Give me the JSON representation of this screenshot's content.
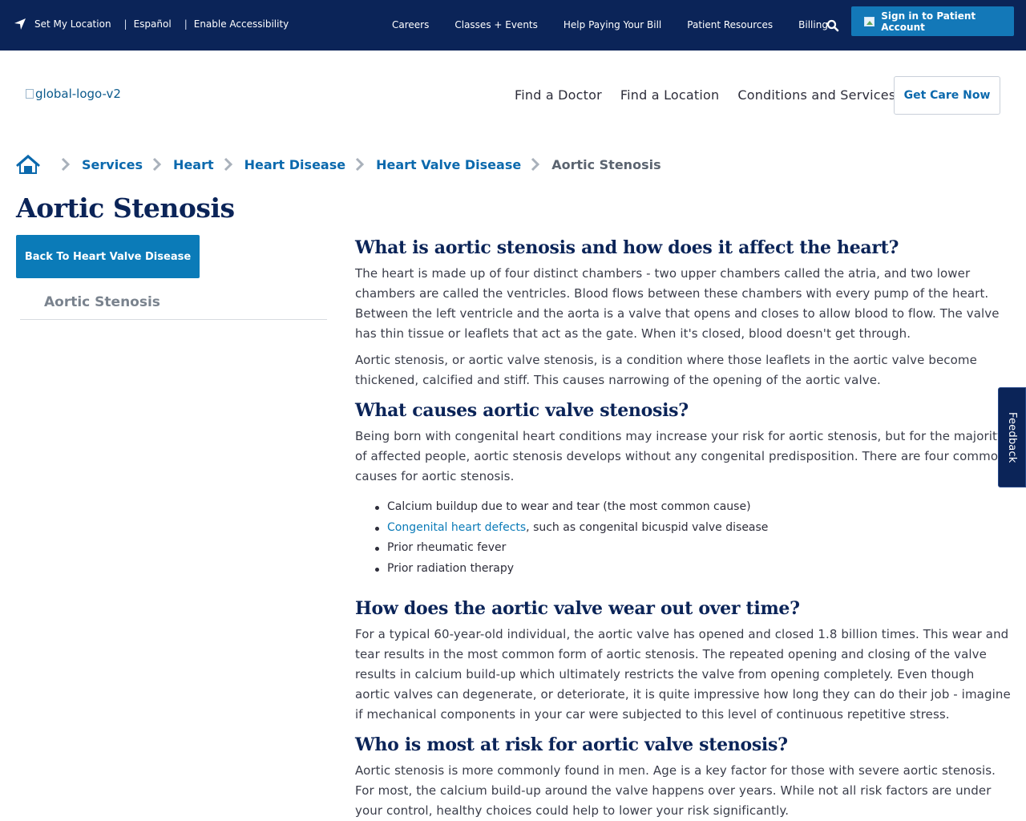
{
  "topbar": {
    "set_location": "Set My Location",
    "espanol": "Español",
    "accessibility": "Enable Accessibility",
    "nav": [
      "Careers",
      "Classes + Events",
      "Help Paying Your Bill",
      "Patient Resources",
      "Billing"
    ],
    "signin": "Sign in to Patient Account"
  },
  "header": {
    "logo_alt": "global-logo-v2",
    "nav": [
      "Find a Doctor",
      "Find a Location",
      "Conditions and Services"
    ],
    "get_care": "Get Care Now"
  },
  "breadcrumb": {
    "items": [
      "Services",
      "Heart",
      "Heart Disease",
      "Heart Valve Disease"
    ],
    "current": "Aortic Stenosis"
  },
  "page": {
    "title": "Aortic Stenosis"
  },
  "sidebar": {
    "back": "Back To Heart Valve Disease",
    "active": "Aortic Stenosis"
  },
  "content": {
    "s1_heading": "What is aortic stenosis and how does it affect the heart?",
    "s1_p1": "The heart is made up of four distinct chambers - two upper chambers called the atria, and two lower chambers are called the ventricles. Blood flows between these chambers with every pump of the heart. Between the left ventricle and the aorta is a valve that opens and closes to allow blood to flow. The valve has thin tissue or leaflets that act as the gate. When it's closed, blood doesn't get through.",
    "s1_p2": "Aortic stenosis, or aortic valve stenosis, is a condition where those leaflets in the aortic valve become thickened, calcified and stiff. This causes narrowing of the opening of the aortic valve.",
    "s2_heading": "What causes aortic valve stenosis?",
    "s2_p1": "Being born with congenital heart conditions may increase your risk for aortic stenosis, but for the majority of affected people, aortic stenosis develops without any congenital predisposition. There are four common causes for aortic stenosis.",
    "s2_list": {
      "item1": "Calcium buildup due to wear and tear (the most common cause)",
      "item2_link": "Congenital heart defects",
      "item2_rest": ", such as congenital bicuspid valve disease",
      "item3": "Prior rheumatic fever",
      "item4": "Prior radiation therapy"
    },
    "s3_heading": "How does the aortic valve wear out over time?",
    "s3_p1": "For a typical 60-year-old individual, the aortic valve has opened and closed 1.8 billion times. This wear and tear results in the most common form of aortic stenosis. The repeated opening and closing of the valve results in calcium build-up which ultimately restricts the valve from opening completely. Even though aortic valves can degenerate, or deteriorate, it is quite impressive how long they can do their job - imagine if mechanical components in your car were subjected to this level of continuous repetitive stress.",
    "s4_heading": "Who is most at risk for aortic valve stenosis?",
    "s4_p1": "Aortic stenosis is more commonly found in men. Age is a key factor for those with severe aortic stenosis. For most, the calcium build-up around the valve happens over years. While not all risk factors are under your control, healthy choices could help to lower your risk significantly."
  },
  "feedback": "Feedback",
  "icons": {
    "location": "location-arrow-icon",
    "search": "search-icon",
    "home": "home-icon",
    "chevron": "chevron-right-icon"
  },
  "colors": {
    "navy": "#0b2458",
    "brand_blue": "#0b7bb8",
    "link_blue": "#0b69ad"
  }
}
